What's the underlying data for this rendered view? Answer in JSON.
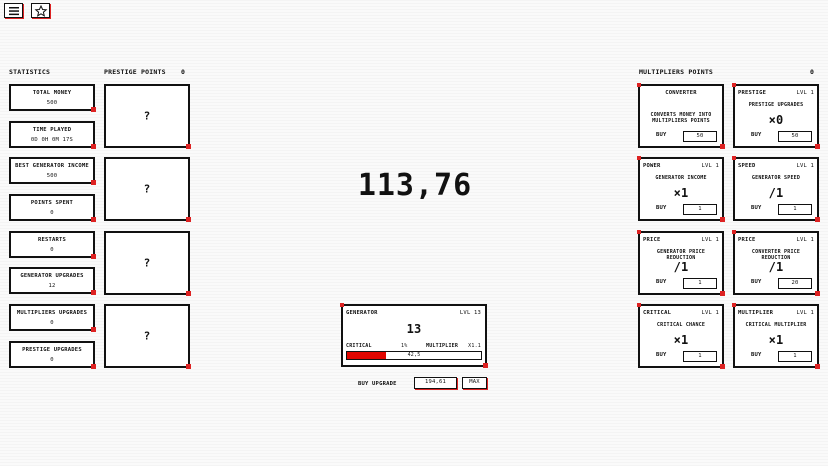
{
  "toolbar": {
    "menu_icon": "menu-icon",
    "star_icon": "star-icon"
  },
  "statistics": {
    "title": "STATISTICS",
    "items": [
      {
        "label": "TOTAL MONEY",
        "value": "500"
      },
      {
        "label": "TIME PLAYED",
        "value": "0D 0H 0M 17S"
      },
      {
        "label": "BEST GENERATOR INCOME",
        "value": "500"
      },
      {
        "label": "POINTS SPENT",
        "value": "0"
      },
      {
        "label": "RESTARTS",
        "value": "0"
      },
      {
        "label": "GENERATOR UPGRADES",
        "value": "12"
      },
      {
        "label": "MULTIPLIERS UPGRADES",
        "value": "0"
      },
      {
        "label": "PRESTIGE UPGRADES",
        "value": "0"
      }
    ]
  },
  "prestige": {
    "title": "PRESTIGE POINTS",
    "count": "0",
    "slots": [
      "?",
      "?",
      "?",
      "?"
    ]
  },
  "money": {
    "value": "113,76"
  },
  "generator": {
    "title": "GENERATOR",
    "level": "LVL 13",
    "number": "13",
    "critical_label": "CRITICAL",
    "critical_value": "1%",
    "multiplier_label": "MULTIPLIER",
    "multiplier_value": "x1.1",
    "progress_text": "42,5",
    "progress_fraction": 0.29,
    "buy_label": "BUY UPGRADE",
    "buy_price": "194,61",
    "max_label": "MAX"
  },
  "multipliers": {
    "title": "MULTIPLIERS POINTS",
    "count": "0",
    "cards": [
      {
        "title": "CONVERTER",
        "level": "",
        "desc": "CONVERTS MONEY INTO MULTIPLIERS POINTS",
        "value": "",
        "buy": "BUY",
        "price": "50"
      },
      {
        "title": "PRESTIGE",
        "level": "LVL 1",
        "desc": "PRESTIGE UPGRADES",
        "value": "×0",
        "buy": "BUY",
        "price": "50"
      },
      {
        "title": "POWER",
        "level": "LVL 1",
        "desc": "GENERATOR INCOME",
        "value": "×1",
        "buy": "BUY",
        "price": "1"
      },
      {
        "title": "SPEED",
        "level": "LVL 1",
        "desc": "GENERATOR SPEED",
        "value": "/1",
        "buy": "BUY",
        "price": "1"
      },
      {
        "title": "PRICE",
        "level": "LVL 1",
        "desc": "GENERATOR PRICE REDUCTION",
        "value": "/1",
        "buy": "BUY",
        "price": "1"
      },
      {
        "title": "PRICE",
        "level": "LVL 1",
        "desc": "CONVERTER PRICE REDUCTION",
        "value": "/1",
        "buy": "BUY",
        "price": "20"
      },
      {
        "title": "CRITICAL",
        "level": "LVL 1",
        "desc": "CRITICAL CHANCE",
        "value": "×1",
        "buy": "BUY",
        "price": "1"
      },
      {
        "title": "MULTIPLIER",
        "level": "LVL 1",
        "desc": "CRITICAL MULTIPLIER",
        "value": "×1",
        "buy": "BUY",
        "price": "1"
      }
    ]
  },
  "colors": {
    "accent": "#e10600",
    "border": "#111111"
  }
}
